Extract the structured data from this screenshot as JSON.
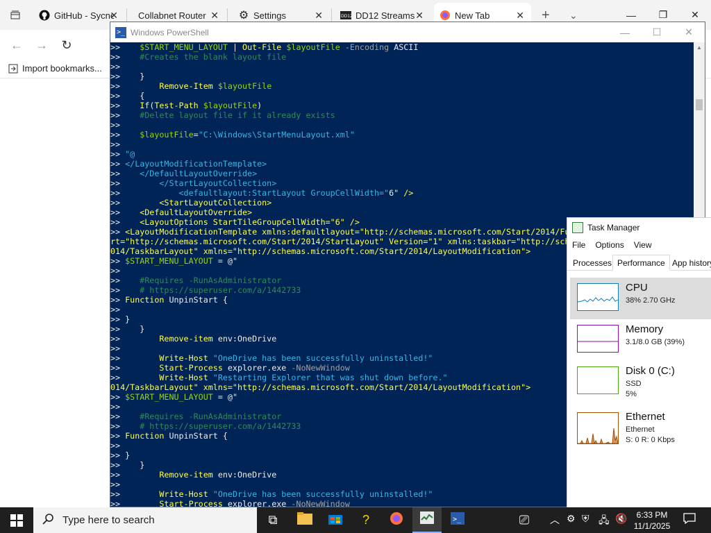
{
  "browser": {
    "tabs": [
      {
        "label": "GitHub - Sycnex",
        "icon": "github-icon"
      },
      {
        "label": "Collabnet Router",
        "icon": "blank-icon"
      },
      {
        "label": "Settings",
        "icon": "gear-icon"
      },
      {
        "label": "DD12 Streams",
        "icon": "dd12-icon"
      },
      {
        "label": "New Tab",
        "icon": "firefox-icon"
      }
    ],
    "import_bookmarks": "Import bookmarks..."
  },
  "powershell": {
    "title": "Windows PowerShell",
    "lines": [
      [
        [
          ">>    ",
          "def"
        ],
        [
          "$START_MENU_LAYOUT",
          "var"
        ],
        [
          " | ",
          "def"
        ],
        [
          "Out-File",
          "cmd"
        ],
        [
          " ",
          "def"
        ],
        [
          "$layoutFile",
          "var"
        ],
        [
          " -Encoding",
          "param"
        ],
        [
          " ASCII",
          "def"
        ]
      ],
      [
        [
          ">>    ",
          "def"
        ],
        [
          "#Creates the blank layout file",
          "com"
        ]
      ],
      [
        [
          ">>",
          "def"
        ]
      ],
      [
        [
          ">>    }",
          "def"
        ]
      ],
      [
        [
          ">>        ",
          "def"
        ],
        [
          "Remove-Item",
          "cmd"
        ],
        [
          " ",
          "def"
        ],
        [
          "$layoutFile",
          "var"
        ]
      ],
      [
        [
          ">>    {",
          "def"
        ]
      ],
      [
        [
          ">>    ",
          "def"
        ],
        [
          "If",
          "cmd"
        ],
        [
          "(",
          "def"
        ],
        [
          "Test-Path",
          "cmd"
        ],
        [
          " ",
          "def"
        ],
        [
          "$layoutFile",
          "var"
        ],
        [
          ")",
          "def"
        ]
      ],
      [
        [
          ">>    ",
          "def"
        ],
        [
          "#Delete layout file if it already exists",
          "com"
        ]
      ],
      [
        [
          ">>",
          "def"
        ]
      ],
      [
        [
          ">>    ",
          "def"
        ],
        [
          "$layoutFile",
          "var"
        ],
        [
          "=",
          "def"
        ],
        [
          "\"C:\\Windows\\StartMenuLayout.xml\"",
          "str"
        ]
      ],
      [
        [
          ">>",
          "def"
        ]
      ],
      [
        [
          ">> ",
          "def"
        ],
        [
          "\"@",
          "str"
        ]
      ],
      [
        [
          ">> ",
          "def"
        ],
        [
          "</LayoutModificationTemplate>",
          "str"
        ]
      ],
      [
        [
          ">>    ",
          "def"
        ],
        [
          "</DefaultLayoutOverride>",
          "str"
        ]
      ],
      [
        [
          ">>        ",
          "def"
        ],
        [
          "</StartLayoutCollection>",
          "str"
        ]
      ],
      [
        [
          ">>            ",
          "def"
        ],
        [
          "<defaultlayout:StartLayout GroupCellWidth=\"",
          "str"
        ],
        [
          "6",
          "def"
        ],
        [
          "\" />",
          "cmd"
        ]
      ],
      [
        [
          ">>        ",
          "def"
        ],
        [
          "<StartLayoutCollection>",
          "cmd"
        ]
      ],
      [
        [
          ">>    ",
          "def"
        ],
        [
          "<DefaultLayoutOverride>",
          "cmd"
        ]
      ],
      [
        [
          ">>    ",
          "def"
        ],
        [
          "<LayoutOptions StartTileGroupCellWidth=\"6\" />",
          "cmd"
        ]
      ],
      [
        [
          ">> ",
          "def"
        ],
        [
          "<LayoutModificationTemplate xmlns:defaultlayout=\"http://schemas.microsoft.com/Start/2014/Fu",
          "cmd"
        ]
      ],
      [
        [
          "rt=\"http://schemas.microsoft.com/Start/2014/StartLayout\" Version=\"1\" xmlns:taskbar=\"http://sch",
          "cmd"
        ]
      ],
      [
        [
          "014/TaskbarLayout\" xmlns=\"http://schemas.microsoft.com/Start/2014/LayoutModification\">",
          "cmd"
        ]
      ],
      [
        [
          ">> ",
          "def"
        ],
        [
          "$START_MENU_LAYOUT",
          "var"
        ],
        [
          " = @\"",
          "def"
        ]
      ],
      [
        [
          ">>",
          "def"
        ]
      ],
      [
        [
          ">>    ",
          "def"
        ],
        [
          "#Requires -RunAsAdministrator",
          "com"
        ]
      ],
      [
        [
          ">>    ",
          "def"
        ],
        [
          "# https://superuser.com/a/1442733",
          "com"
        ]
      ],
      [
        [
          ">> ",
          "def"
        ],
        [
          "Function",
          "cmd"
        ],
        [
          " UnpinStart {",
          "def"
        ]
      ],
      [
        [
          ">>",
          "def"
        ]
      ],
      [
        [
          ">> }",
          "def"
        ]
      ],
      [
        [
          ">>    }",
          "def"
        ]
      ],
      [
        [
          ">>        ",
          "def"
        ],
        [
          "Remove-item",
          "cmd"
        ],
        [
          " env:OneDrive",
          "def"
        ]
      ],
      [
        [
          ">>",
          "def"
        ]
      ],
      [
        [
          ">>        ",
          "def"
        ],
        [
          "Write-Host",
          "cmd"
        ],
        [
          " ",
          "def"
        ],
        [
          "\"OneDrive has been successfully uninstalled!\"",
          "str"
        ]
      ],
      [
        [
          ">>        ",
          "def"
        ],
        [
          "Start-Process",
          "cmd"
        ],
        [
          " explorer.exe",
          "def"
        ],
        [
          " -NoNewWindow",
          "param"
        ]
      ],
      [
        [
          ">>        ",
          "def"
        ],
        [
          "Write-Host",
          "cmd"
        ],
        [
          " ",
          "def"
        ],
        [
          "\"Restarting Explorer that was shut down before.\"",
          "str"
        ]
      ],
      [
        [
          "014/TaskbarLayout\" xmlns=\"http://schemas.microsoft.com/Start/2014/LayoutModification\">",
          "cmd"
        ]
      ],
      [
        [
          ">> ",
          "def"
        ],
        [
          "$START_MENU_LAYOUT",
          "var"
        ],
        [
          " = @\"",
          "def"
        ]
      ],
      [
        [
          ">>",
          "def"
        ]
      ],
      [
        [
          ">>    ",
          "def"
        ],
        [
          "#Requires -RunAsAdministrator",
          "com"
        ]
      ],
      [
        [
          ">>    ",
          "def"
        ],
        [
          "# https://superuser.com/a/1442733",
          "com"
        ]
      ],
      [
        [
          ">> ",
          "def"
        ],
        [
          "Function",
          "cmd"
        ],
        [
          " UnpinStart {",
          "def"
        ]
      ],
      [
        [
          ">>",
          "def"
        ]
      ],
      [
        [
          ">> }",
          "def"
        ]
      ],
      [
        [
          ">>    }",
          "def"
        ]
      ],
      [
        [
          ">>        ",
          "def"
        ],
        [
          "Remove-item",
          "cmd"
        ],
        [
          " env:OneDrive",
          "def"
        ]
      ],
      [
        [
          ">>",
          "def"
        ]
      ],
      [
        [
          ">>        ",
          "def"
        ],
        [
          "Write-Host",
          "cmd"
        ],
        [
          " ",
          "def"
        ],
        [
          "\"OneDrive has been successfully uninstalled!\"",
          "str"
        ]
      ],
      [
        [
          ">>        ",
          "def"
        ],
        [
          "Start-Process",
          "cmd"
        ],
        [
          " explorer.exe",
          "def"
        ],
        [
          " -NoNewWindow",
          "param"
        ]
      ]
    ],
    "colors": {
      "background": "#012456"
    }
  },
  "taskmanager": {
    "title": "Task Manager",
    "menu": [
      "File",
      "Options",
      "View"
    ],
    "tabs": [
      "Processes",
      "Performance",
      "App history"
    ],
    "items": [
      {
        "name": "CPU",
        "line1": "38%  2.70 GHz",
        "line2": "",
        "color": "#117dbb"
      },
      {
        "name": "Memory",
        "line1": "3.1/8.0 GB (39%)",
        "line2": "",
        "color": "#8b12ae"
      },
      {
        "name": "Disk 0 (C:)",
        "line1": "SSD",
        "line2": "5%",
        "color": "#4da60c"
      },
      {
        "name": "Ethernet",
        "line1": "Ethernet",
        "line2": "S: 0  R: 0 Kbps",
        "color": "#a74f01"
      }
    ]
  },
  "taskbar": {
    "search_placeholder": "Type here to search",
    "time": "6:33 PM",
    "date": "11/1/2025"
  }
}
